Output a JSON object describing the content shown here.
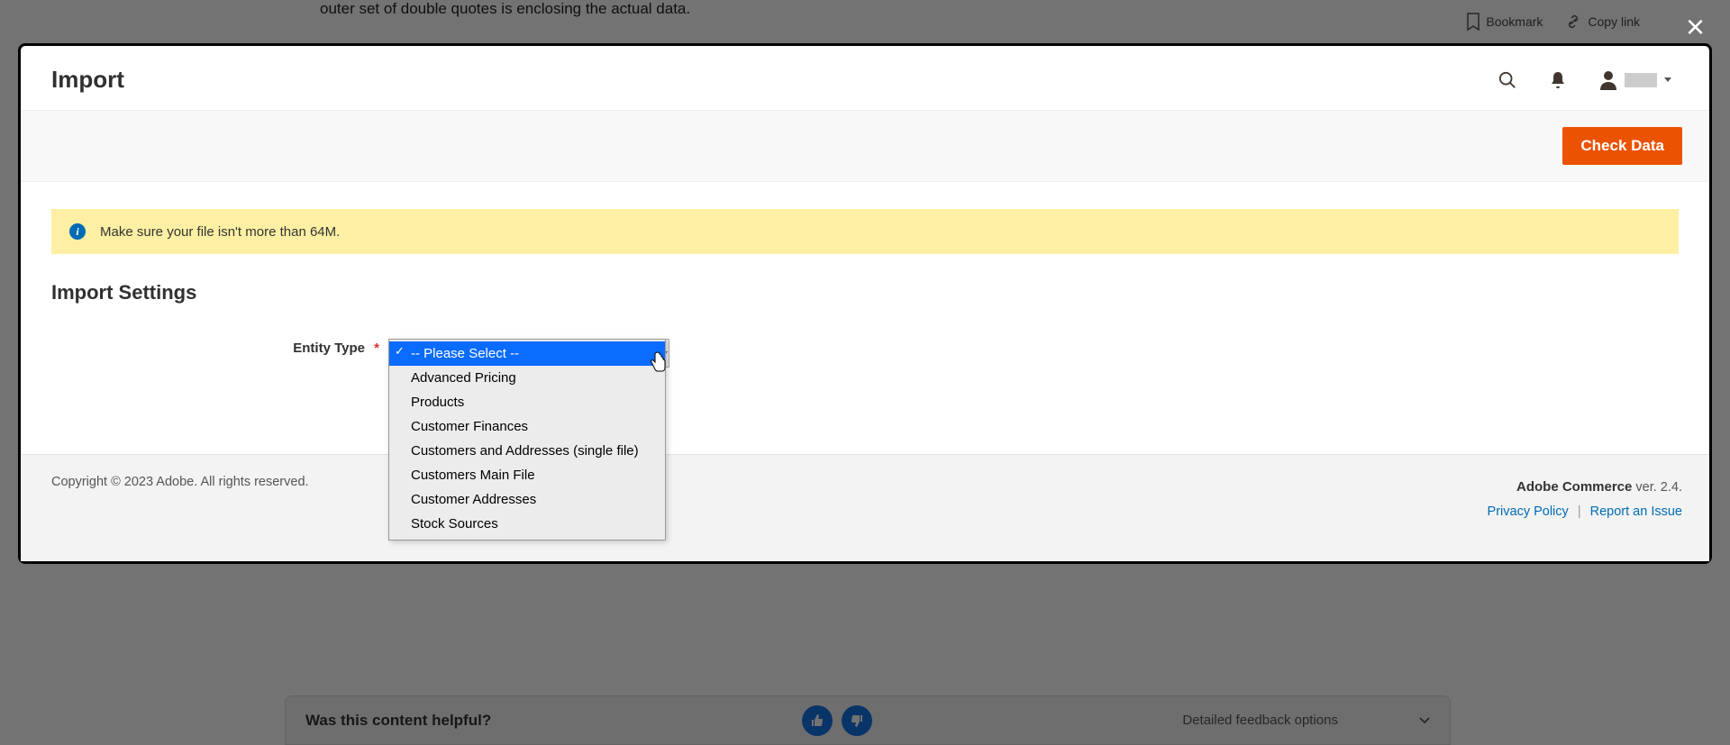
{
  "background": {
    "paragraph": "outer set of double quotes is enclosing the actual data.",
    "bookmark": "Bookmark",
    "copy_link": "Copy link",
    "feedback_prompt": "Was this content helpful?",
    "feedback_detailed": "Detailed feedback options"
  },
  "modal": {
    "title": "Import",
    "check_data_label": "Check Data",
    "info_banner": "Make sure your file isn't more than 64M.",
    "section_title": "Import Settings",
    "entity_type_label": "Entity Type",
    "dropdown": {
      "options": [
        "-- Please Select --",
        "Advanced Pricing",
        "Products",
        "Customer Finances",
        "Customers and Addresses (single file)",
        "Customers Main File",
        "Customer Addresses",
        "Stock Sources"
      ]
    },
    "footer": {
      "copyright": "Copyright © 2023 Adobe. All rights reserved.",
      "product": "Adobe Commerce",
      "version": "ver. 2.4.",
      "privacy": "Privacy Policy",
      "report": "Report an Issue"
    }
  }
}
